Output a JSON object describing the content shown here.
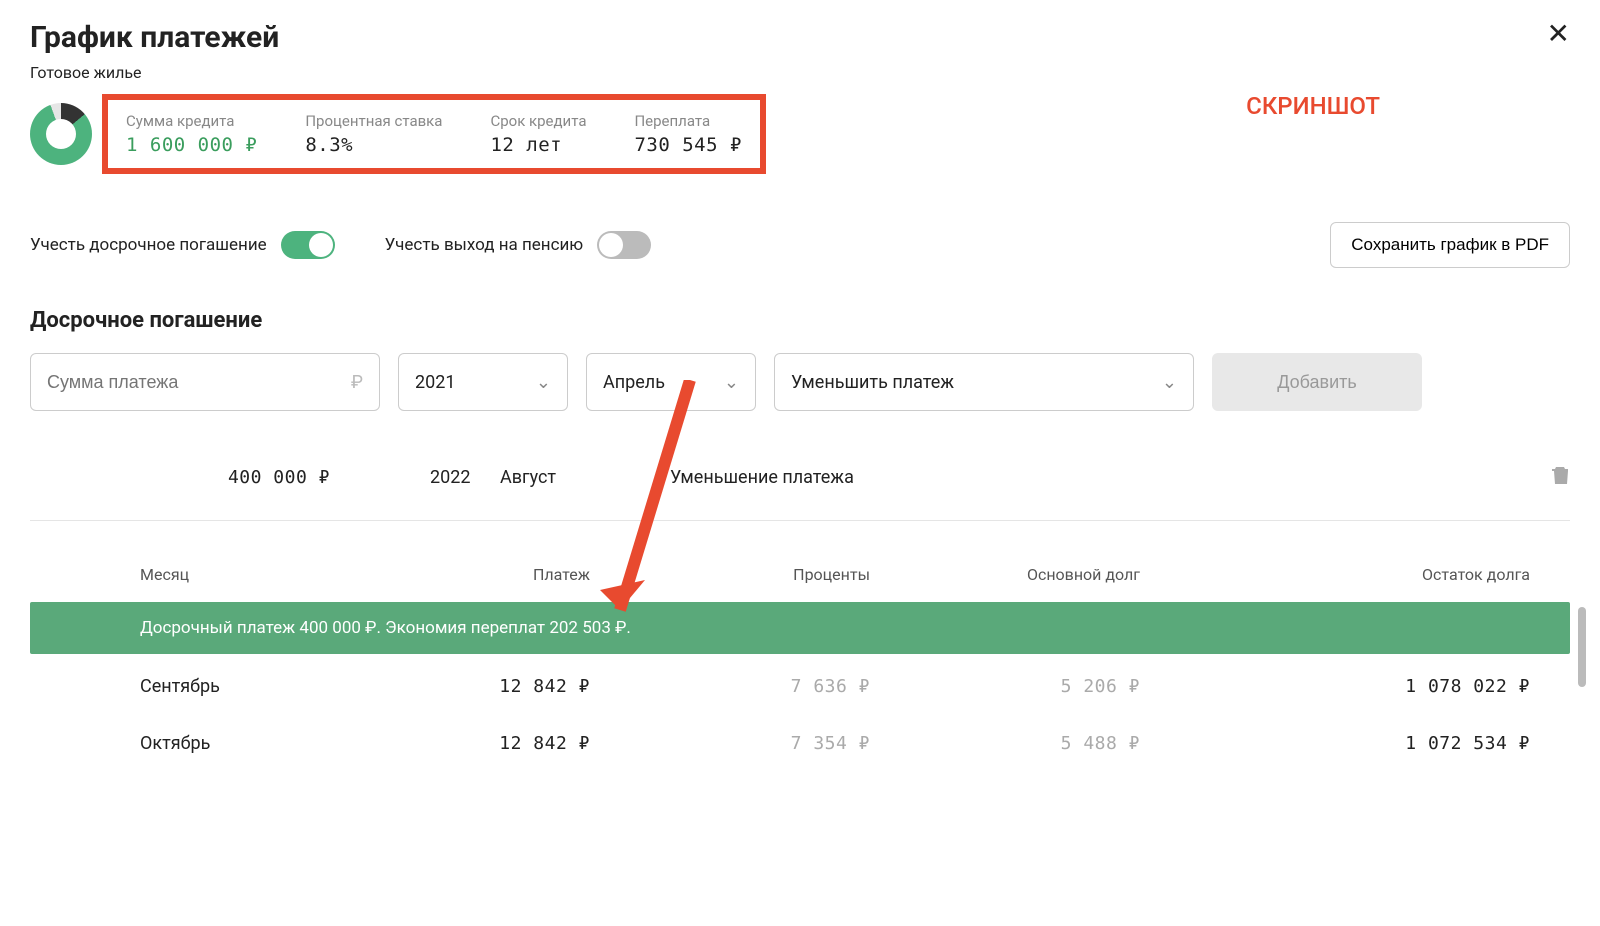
{
  "header": {
    "title": "График платежей",
    "subtitle": "Готовое жилье",
    "screenshot_tag": "СКРИНШОТ"
  },
  "summary": {
    "loan_amount_label": "Сумма кредита",
    "loan_amount_value": "1 600 000 ₽",
    "rate_label": "Процентная ставка",
    "rate_value": "8.3%",
    "term_label": "Срок кредита",
    "term_value": "12 лет",
    "overpay_label": "Переплата",
    "overpay_value": "730 545 ₽"
  },
  "controls": {
    "toggle_early_label": "Учесть досрочное погашение",
    "toggle_early_on": true,
    "toggle_pension_label": "Учесть выход на пенсию",
    "toggle_pension_on": false,
    "pdf_button": "Сохранить график в PDF"
  },
  "early_section": {
    "title": "Досрочное погашение",
    "amount_placeholder": "Сумма платежа",
    "currency": "₽",
    "year_value": "2021",
    "month_value": "Апрель",
    "action_value": "Уменьшить платеж",
    "add_button": "Добавить"
  },
  "existing_payment": {
    "amount": "400 000 ₽",
    "year": "2022",
    "month": "Август",
    "action": "Уменьшение платежа"
  },
  "table": {
    "headers": {
      "month": "Месяц",
      "payment": "Платеж",
      "interest": "Проценты",
      "principal": "Основной долг",
      "balance": "Остаток долга"
    },
    "banner": "Досрочный платеж 400 000 ₽. Экономия переплат 202 503 ₽.",
    "rows": [
      {
        "month": "Сентябрь",
        "payment": "12 842 ₽",
        "interest": "7 636 ₽",
        "principal": "5 206 ₽",
        "balance": "1 078 022 ₽"
      },
      {
        "month": "Октябрь",
        "payment": "12 842 ₽",
        "interest": "7 354 ₽",
        "principal": "5 488 ₽",
        "balance": "1 072 534 ₽"
      }
    ]
  }
}
